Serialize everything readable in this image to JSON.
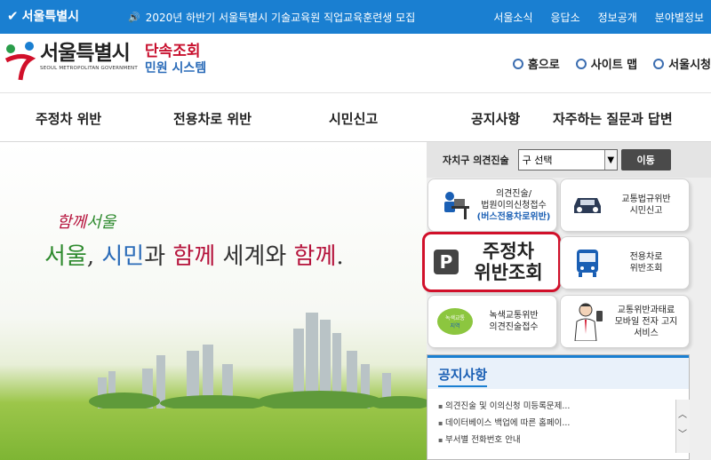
{
  "topbar": {
    "logo": "서울특별시",
    "notice": "2020년 하반기 서울특별시 기술교육원 직업교육훈련생 모집",
    "links": [
      "서울소식",
      "응답소",
      "정보공개",
      "분야별정보"
    ]
  },
  "header": {
    "logo_name": "서울특별시",
    "logo_eng": "SEOUL METROPOLITAN GOVERNMENT",
    "sub_line1": "단속조회",
    "sub_line2": "민원 시스템",
    "util_links": [
      "홈으로",
      "사이트 맵",
      "서울시청"
    ]
  },
  "nav": [
    "주정차 위반",
    "전용차로 위반",
    "시민신고",
    "공지사항",
    "자주하는 질문과 답변"
  ],
  "hero": {
    "small_1": "함께",
    "small_2": "서울",
    "slogan_1": "서울",
    "slogan_2": ", ",
    "slogan_3": "시민",
    "slogan_4": "과 ",
    "slogan_5": "함께",
    "slogan_6": " 세계와 ",
    "slogan_7": "함께",
    "slogan_8": "."
  },
  "panel": {
    "select_label": "자치구 의견진술",
    "select_value": "구 선택",
    "go_button": "이동",
    "cards": {
      "opinion_1": "의견진술/",
      "opinion_2": "법원이의신청접수",
      "opinion_3": "(버스전용차로위반)",
      "report_1": "교통법규위반",
      "report_2": "시민신고",
      "parking_1": "주정차",
      "parking_2": "위반조회",
      "bus_1": "전용차로",
      "bus_2": "위반조회",
      "green_badge": "녹색교통지역",
      "green_1": "녹색교통위반",
      "green_2": "의견진술접수",
      "mobile_1": "교통위반과태료",
      "mobile_2": "모바일 전자 고지",
      "mobile_3": "서비스"
    }
  },
  "notice": {
    "title": "공지사항",
    "items": [
      "의견진술 및 이의신청 미등록문제...",
      "데이터베이스 백업에 따른 홈페이...",
      "부서별 전화번호 안내"
    ]
  },
  "colors": {
    "primary_blue": "#1a7fd1",
    "highlight_red": "#d1102a",
    "brand_red": "#c8102e"
  }
}
